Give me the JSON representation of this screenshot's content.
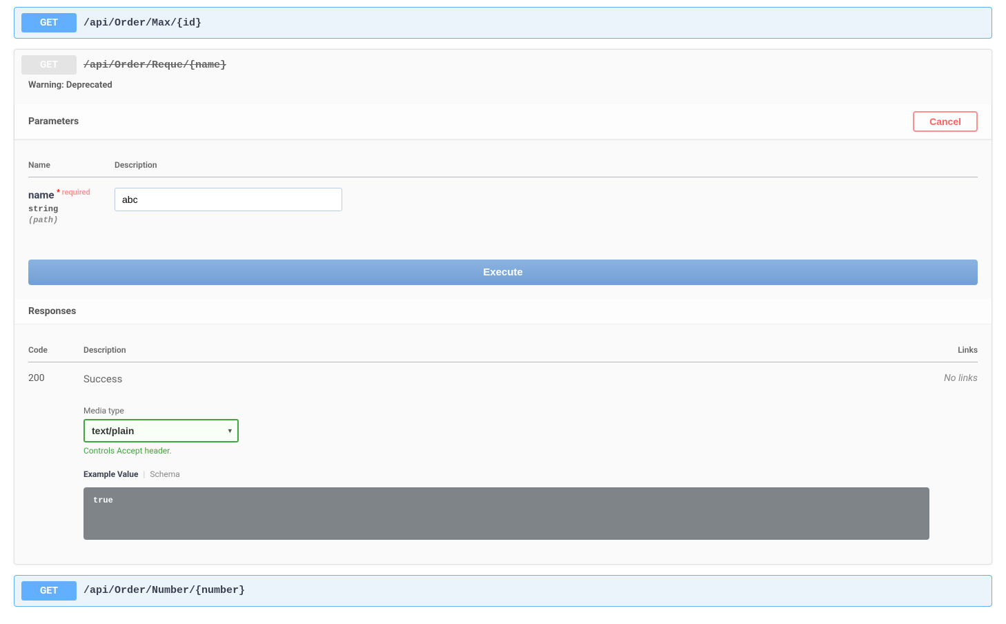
{
  "endpoint_collapsed_top": {
    "method": "GET",
    "path": "/api/Order/Max/{id}"
  },
  "endpoint_expanded": {
    "method": "GET",
    "path": "/api/Order/Reque/{name}",
    "warning": "Warning: Deprecated",
    "section_parameters": "Parameters",
    "cancel_label": "Cancel",
    "table": {
      "header_name": "Name",
      "header_description": "Description"
    },
    "param": {
      "name": "name",
      "required": "required",
      "type": "string",
      "in": "(path)",
      "value": "abc"
    },
    "execute_label": "Execute",
    "section_responses": "Responses",
    "resp_table": {
      "header_code": "Code",
      "header_description": "Description",
      "header_links": "Links"
    },
    "response": {
      "code": "200",
      "desc": "Success",
      "media_type_label": "Media type",
      "media_type_value": "text/plain",
      "media_type_hint": "Controls Accept header.",
      "tab_example": "Example Value",
      "tab_schema": "Schema",
      "example_body": "true",
      "links": "No links"
    }
  },
  "endpoint_collapsed_bottom": {
    "method": "GET",
    "path": "/api/Order/Number/{number}"
  }
}
